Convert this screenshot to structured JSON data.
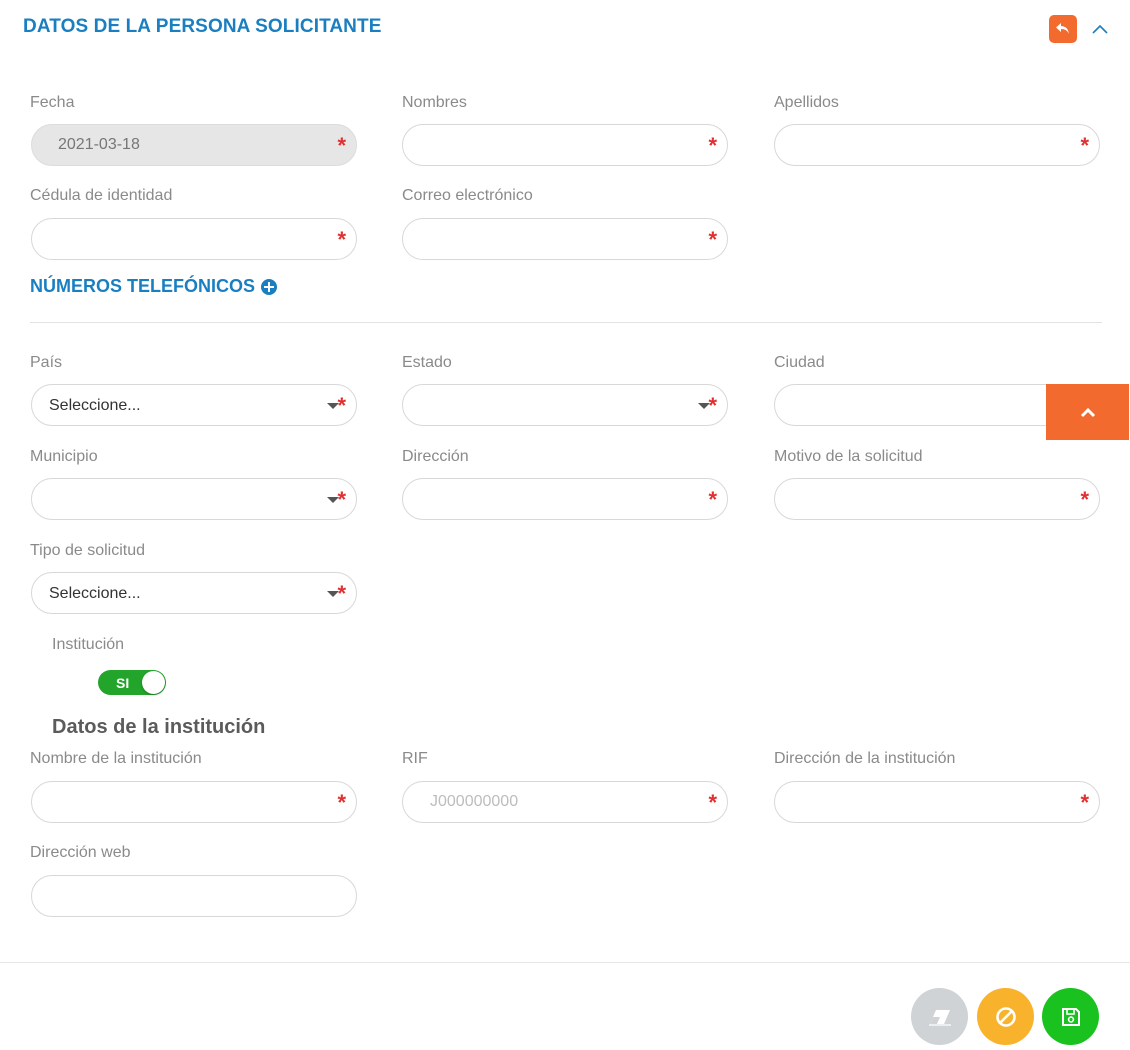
{
  "header": {
    "title": "DATOS DE LA PERSONA SOLICITANTE"
  },
  "fields": {
    "fecha": {
      "label": "Fecha",
      "value": "2021-03-18"
    },
    "nombres": {
      "label": "Nombres"
    },
    "apellidos": {
      "label": "Apellidos"
    },
    "cedula": {
      "label": "Cédula de identidad"
    },
    "correo": {
      "label": "Correo electrónico"
    },
    "pais": {
      "label": "País",
      "value": "Seleccione..."
    },
    "estado": {
      "label": "Estado"
    },
    "ciudad": {
      "label": "Ciudad"
    },
    "municipio": {
      "label": "Municipio"
    },
    "direccion": {
      "label": "Dirección"
    },
    "motivo": {
      "label": "Motivo de la solicitud"
    },
    "tipo": {
      "label": "Tipo de solicitud",
      "value": "Seleccione..."
    },
    "institucion": {
      "label": "Institución",
      "toggle_label": "SI",
      "toggle_on": true
    },
    "nombre_inst": {
      "label": "Nombre de la institución"
    },
    "rif": {
      "label": "RIF",
      "placeholder": "J000000000"
    },
    "direccion_inst": {
      "label": "Dirección de la institución"
    },
    "web": {
      "label": "Dirección web"
    }
  },
  "phones": {
    "title": "NÚMEROS TELEFÓNICOS"
  },
  "institution_section": {
    "title": "Datos de la institución"
  },
  "required_mark": "*",
  "colors": {
    "accent": "#1a7fc1",
    "orange": "#f26a2d",
    "required": "#e03030",
    "toggle": "#22a52a",
    "save": "#19c21f",
    "cancel": "#f9b22c",
    "clear": "#cfd3d6"
  },
  "icons": {
    "back": "undo-arrow-icon",
    "collapse": "chevron-up-icon",
    "add_phone": "plus-circle-icon",
    "scroll_top": "chevron-up-icon",
    "clear": "eraser-icon",
    "cancel": "ban-icon",
    "save": "floppy-disk-icon"
  }
}
